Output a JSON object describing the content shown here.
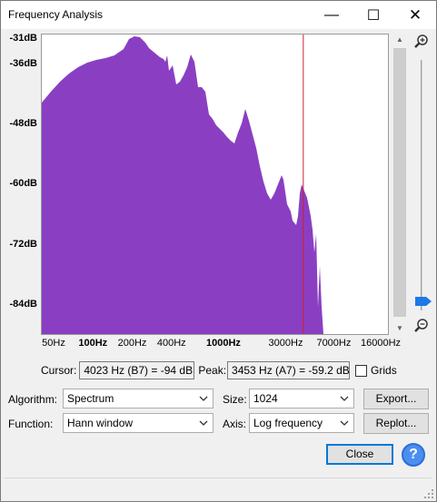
{
  "window": {
    "title": "Frequency Analysis",
    "minimize_glyph": "—",
    "maximize_glyph": "☐",
    "close_glyph": "✕"
  },
  "plot": {
    "y_labels": [
      {
        "text": "-31dB",
        "db": -31
      },
      {
        "text": "-36dB",
        "db": -36
      },
      {
        "text": "-48dB",
        "db": -48
      },
      {
        "text": "-60dB",
        "db": -60
      },
      {
        "text": "-72dB",
        "db": -72
      },
      {
        "text": "-84dB",
        "db": -84
      }
    ],
    "x_labels": [
      {
        "text": "50Hz",
        "hz": 50,
        "bold": false
      },
      {
        "text": "100Hz",
        "hz": 100,
        "bold": true
      },
      {
        "text": "200Hz",
        "hz": 200,
        "bold": false
      },
      {
        "text": "400Hz",
        "hz": 400,
        "bold": false
      },
      {
        "text": "1000Hz",
        "hz": 1000,
        "bold": true
      },
      {
        "text": "3000Hz",
        "hz": 3000,
        "bold": false
      },
      {
        "text": "7000Hz",
        "hz": 7000,
        "bold": false
      },
      {
        "text": "16000Hz",
        "hz": 16000,
        "bold": false
      }
    ],
    "fill_color": "#8a3fc2",
    "cursor_color": "#d0202a",
    "cursor_hz": 4023
  },
  "cursor": {
    "label": "Cursor:",
    "value": "4023 Hz (B7) = -94 dB"
  },
  "peak": {
    "label": "Peak:",
    "value": "3453 Hz (A7) = -59.2 dB"
  },
  "grids": {
    "label": "Grids",
    "checked": false
  },
  "algorithm": {
    "label": "Algorithm:",
    "value": "Spectrum"
  },
  "size": {
    "label": "Size:",
    "value": "1024"
  },
  "function": {
    "label": "Function:",
    "value": "Hann window"
  },
  "axis": {
    "label": "Axis:",
    "value": "Log frequency"
  },
  "buttons": {
    "export": "Export...",
    "replot": "Replot...",
    "close": "Close",
    "help": "?"
  },
  "icons": {
    "zoom_in": "zoom-in-icon",
    "zoom_out": "zoom-out-icon",
    "help": "help-icon"
  }
}
